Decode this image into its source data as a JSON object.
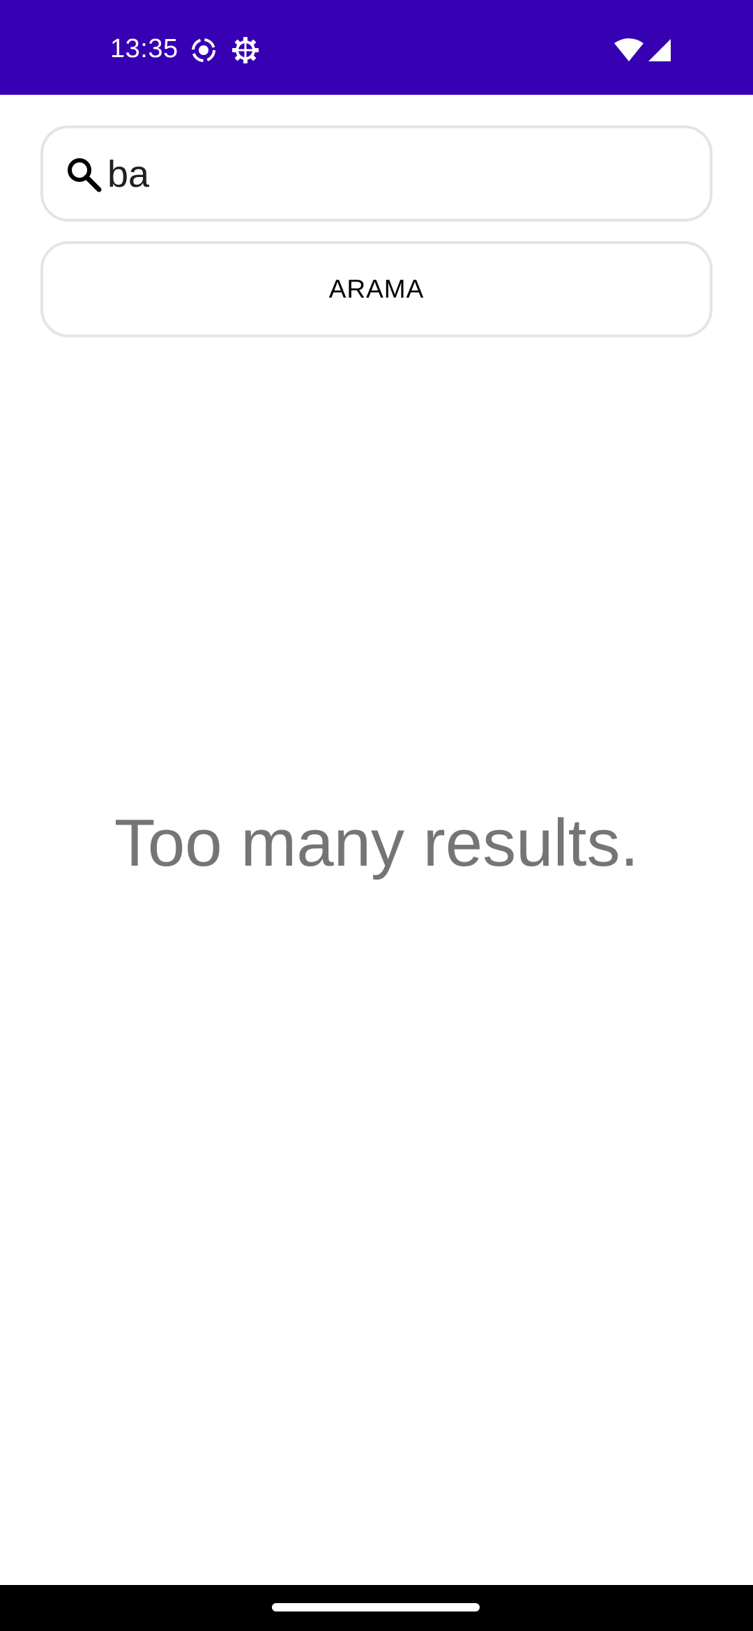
{
  "status_bar": {
    "time": "13:35",
    "background_color": "#3700b3",
    "icons": [
      "screen-record-icon",
      "settings-gear-icon",
      "wifi-icon",
      "cell-signal-icon"
    ]
  },
  "search": {
    "value": "ba",
    "icon": "search-icon"
  },
  "search_button": {
    "label": "ARAMA"
  },
  "result": {
    "message": "Too many results."
  }
}
